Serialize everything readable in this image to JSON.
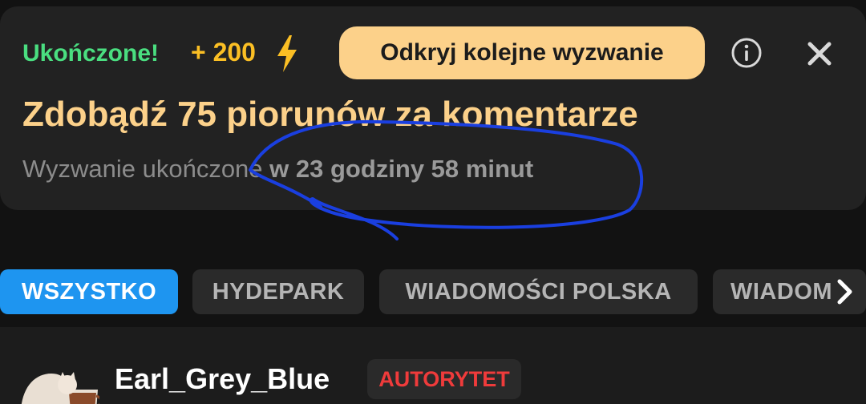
{
  "challenge": {
    "status": "Ukończone!",
    "points": "+ 200",
    "bolt_icon": "lightning-bolt",
    "next_button": "Odkryj kolejne wyzwanie",
    "info_icon": "info-circle",
    "close_icon": "close-x",
    "title": "Zdobądź 75 piorunów za komentarze",
    "subtitle_prefix": "Wyzwanie ukończone ",
    "subtitle_time": "w 23 godziny 58 minut"
  },
  "tabs": [
    {
      "label": "WSZYSTKO",
      "active": true
    },
    {
      "label": "HYDEPARK",
      "active": false
    },
    {
      "label": "WIADOMOŚCI POLSKA",
      "active": false
    },
    {
      "label": "WIADOM",
      "active": false
    }
  ],
  "tabs_next_icon": "chevron-right",
  "post": {
    "username": "Earl_Grey_Blue",
    "badge": "AUTORYTET",
    "avatar_icon": "cat-in-cup"
  },
  "colors": {
    "background": "#121212",
    "card": "#222222",
    "completed_green": "#4ade80",
    "points_yellow": "#fbbf24",
    "accent_peach": "#fcd18a",
    "tab_active_blue": "#1e95f0",
    "badge_red": "#ef3b3b",
    "scribble_blue": "#1a3fe0"
  }
}
